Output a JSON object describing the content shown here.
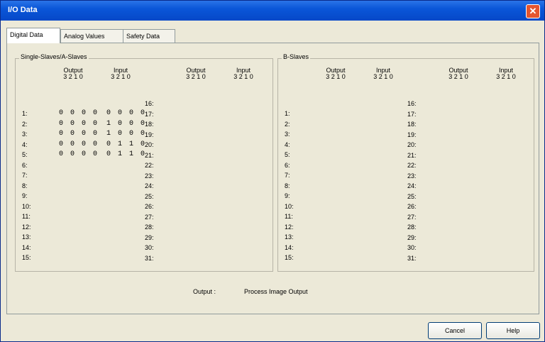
{
  "window": {
    "title": "I/O Data",
    "close_glyph": "✕"
  },
  "tabs": [
    {
      "label": "Digital Data",
      "active": true
    },
    {
      "label": "Analog Values",
      "active": false
    },
    {
      "label": "Safety Data",
      "active": false
    }
  ],
  "groups": {
    "single": {
      "title": "Single-Slaves/A-Slaves",
      "headers": {
        "output": "Output",
        "input": "Input",
        "bits": "3 2 1 0"
      },
      "left_labels": [
        "1:",
        "2:",
        "3:",
        "4:",
        "5:",
        "6:",
        "7:",
        "8:",
        "9:",
        "10:",
        "11:",
        "12:",
        "13:",
        "14:",
        "15:"
      ],
      "right_labels": [
        "16:",
        "17:",
        "18:",
        "19:",
        "20:",
        "21:",
        "22:",
        "23:",
        "24:",
        "25:",
        "26:",
        "27:",
        "28:",
        "29:",
        "30:",
        "31:"
      ],
      "rows": [
        {
          "output": "0 0 0 0",
          "input": "0 0 0 0"
        },
        {
          "output": "0 0 0 0",
          "input": "1 0 0 0"
        },
        {
          "output": "0 0 0 0",
          "input": "1 0 0 0"
        },
        {
          "output": "0 0 0 0",
          "input": "0 1 1 0"
        },
        {
          "output": "0 0 0 0",
          "input": "0 1 1 0"
        }
      ]
    },
    "b": {
      "title": "B-Slaves",
      "headers": {
        "output": "Output",
        "input": "Input",
        "bits": "3 2 1 0"
      },
      "left_labels": [
        "1:",
        "2:",
        "3:",
        "4:",
        "5:",
        "6:",
        "7:",
        "8:",
        "9:",
        "10:",
        "11:",
        "12:",
        "13:",
        "14:",
        "15:"
      ],
      "right_labels": [
        "16:",
        "17:",
        "18:",
        "19:",
        "20:",
        "21:",
        "22:",
        "23:",
        "24:",
        "25:",
        "26:",
        "27:",
        "28:",
        "29:",
        "30:",
        "31:"
      ]
    }
  },
  "legend": {
    "label": "Output :",
    "value": "Process Image Output"
  },
  "buttons": {
    "cancel": "Cancel",
    "help": "Help"
  }
}
